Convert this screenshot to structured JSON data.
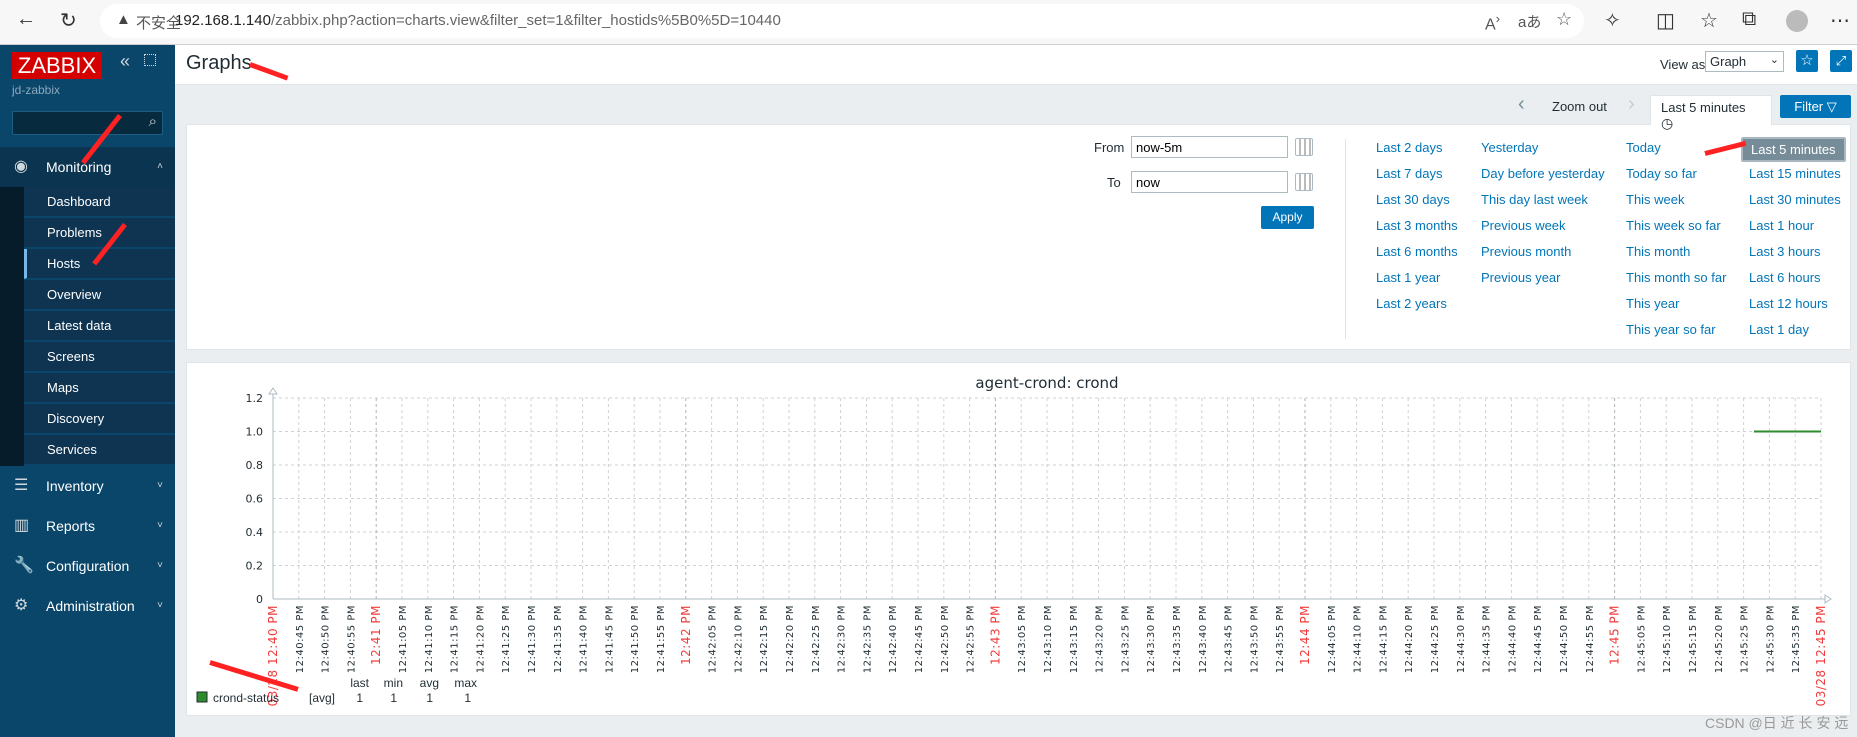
{
  "browser": {
    "insecure": "不安全",
    "url_host": "192.168.1.140",
    "url_path": "/zabbix.php?action=charts.view&filter_set=1&filter_hostids%5B0%5D=10440",
    "icons": [
      "back-icon",
      "reload-icon",
      "read-aloud-icon",
      "translate-icon",
      "add-favorite-icon",
      "extensions-icon",
      "split-screen-icon",
      "favorites-icon",
      "collections-icon",
      "profile-icon",
      "more-icon"
    ]
  },
  "sidebar": {
    "logo": "ZABBIX",
    "server": "jd-zabbix",
    "menus": [
      {
        "label": "Monitoring",
        "icon": "eye-icon",
        "expanded": true,
        "items": [
          "Dashboard",
          "Problems",
          "Hosts",
          "Overview",
          "Latest data",
          "Screens",
          "Maps",
          "Discovery",
          "Services"
        ],
        "selected": "Hosts"
      },
      {
        "label": "Inventory",
        "icon": "list-icon"
      },
      {
        "label": "Reports",
        "icon": "bar-chart-icon"
      },
      {
        "label": "Configuration",
        "icon": "wrench-icon"
      },
      {
        "label": "Administration",
        "icon": "gear-icon"
      }
    ]
  },
  "header": {
    "title": "Graphs",
    "view_as_label": "View as",
    "view_as_value": "Graph"
  },
  "timebar": {
    "zoom_out": "Zoom out",
    "active_tab": "Last 5 minutes",
    "filter": "Filter"
  },
  "filter": {
    "from_label": "From",
    "from_value": "now-5m",
    "to_label": "To",
    "to_value": "now",
    "apply": "Apply",
    "columns": [
      [
        "Last 2 days",
        "Last 7 days",
        "Last 30 days",
        "Last 3 months",
        "Last 6 months",
        "Last 1 year",
        "Last 2 years"
      ],
      [
        "Yesterday",
        "Day before yesterday",
        "This day last week",
        "Previous week",
        "Previous month",
        "Previous year"
      ],
      [
        "Today",
        "Today so far",
        "This week",
        "This week so far",
        "This month",
        "This month so far",
        "This year",
        "This year so far"
      ],
      [
        "Last 5 minutes",
        "Last 15 minutes",
        "Last 30 minutes",
        "Last 1 hour",
        "Last 3 hours",
        "Last 6 hours",
        "Last 12 hours",
        "Last 1 day"
      ]
    ],
    "selected": "Last 5 minutes"
  },
  "chart_data": {
    "type": "line",
    "title": "agent-crond: crond",
    "ylim": [
      0,
      1.2
    ],
    "yticks": [
      "0",
      "0.2",
      "0.4",
      "0.6",
      "0.8",
      "1.0",
      "1.2"
    ],
    "xrange": [
      "12:40:40 PM",
      "12:45:40 PM"
    ],
    "tick_interval_seconds": 5,
    "start_label": "03/28 12:40 PM",
    "end_label": "03/28 12:45 PM",
    "minute_labels": [
      "12:41 PM",
      "12:42 PM",
      "12:43 PM",
      "12:44 PM",
      "12:45 PM"
    ],
    "grid": true,
    "series": [
      {
        "name": "crond-status",
        "color": "#2e8b2e",
        "points": [
          [
            "12:45:27 PM",
            1
          ],
          [
            "12:45:40 PM",
            1
          ]
        ]
      }
    ],
    "legend": {
      "headers": [
        "last",
        "min",
        "avg",
        "max"
      ],
      "entries": [
        {
          "name": "crond-status",
          "func": "[avg]",
          "last": "1",
          "min": "1",
          "avg": "1",
          "max": "1",
          "color": "#2e8b2e"
        }
      ]
    },
    "minute_label_color": "#f23b3b"
  },
  "watermark": "CSDN @日 近 长 安 远"
}
